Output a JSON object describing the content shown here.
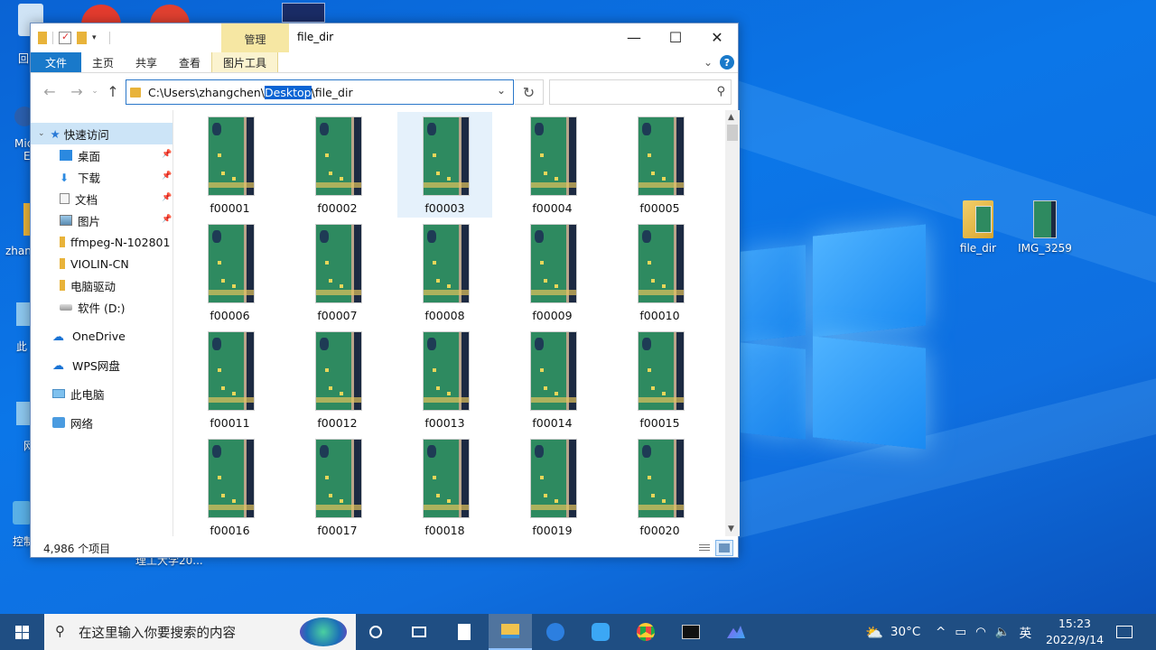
{
  "desktop": {
    "icons": [
      {
        "label": "file_dir"
      },
      {
        "label": "IMG_3259"
      }
    ],
    "peek_labels": [
      "回",
      "Mic",
      "Ec",
      "zhan",
      "此",
      "网",
      "控制",
      "理工大学20..."
    ]
  },
  "window": {
    "title": "file_dir",
    "manage_tab": "管理",
    "ribbon_tabs": [
      "文件",
      "主页",
      "共享",
      "查看",
      "图片工具"
    ],
    "address": {
      "prefix": "C:\\Users\\zhangchen\\",
      "selected": "Desktop",
      "suffix": "\\file_dir"
    },
    "search_placeholder": "",
    "nav": {
      "quick_access": "快速访问",
      "items": [
        {
          "label": "桌面",
          "pinned": true
        },
        {
          "label": "下载",
          "pinned": true
        },
        {
          "label": "文档",
          "pinned": true
        },
        {
          "label": "图片",
          "pinned": true
        },
        {
          "label": "ffmpeg-N-102801",
          "pinned": false
        },
        {
          "label": "VIOLIN-CN",
          "pinned": false
        },
        {
          "label": "电脑驱动",
          "pinned": false
        },
        {
          "label": "软件 (D:)",
          "pinned": false
        }
      ],
      "sections": [
        "OneDrive",
        "WPS网盘",
        "此电脑",
        "网络"
      ]
    },
    "files": [
      "f00001",
      "f00002",
      "f00003",
      "f00004",
      "f00005",
      "f00006",
      "f00007",
      "f00008",
      "f00009",
      "f00010",
      "f00011",
      "f00012",
      "f00013",
      "f00014",
      "f00015",
      "f00016",
      "f00017",
      "f00018",
      "f00019",
      "f00020"
    ],
    "selected_file": "f00003",
    "status": "4,986 个项目"
  },
  "taskbar": {
    "search_placeholder": "在这里输入你要搜索的内容",
    "weather": "30°C",
    "ime": "英",
    "time": "15:23",
    "date": "2022/9/14"
  }
}
